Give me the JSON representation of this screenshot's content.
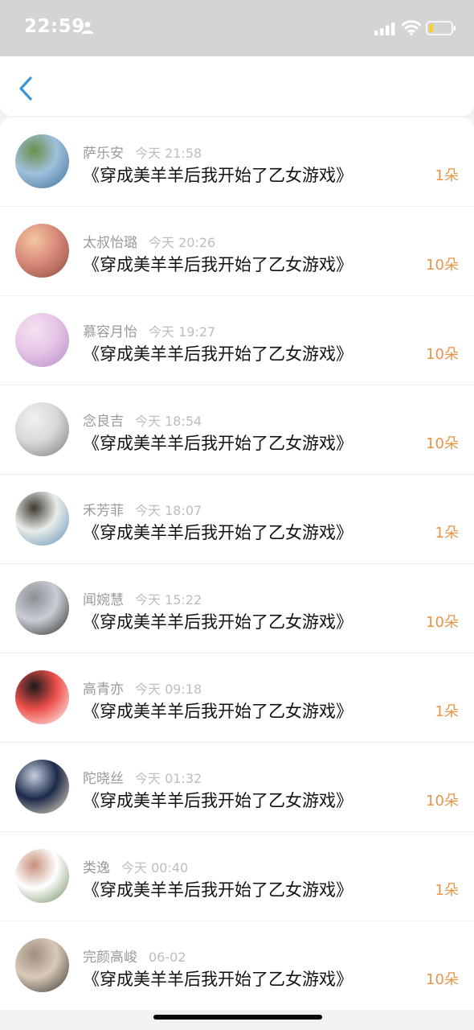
{
  "status_bar": {
    "time": "22:59"
  },
  "gifts": [
    {
      "name": "萨乐安",
      "time": "今天 21:58",
      "book": "《穿成美羊羊后我开始了乙女游戏》",
      "count": "1朵",
      "avatar_colors": [
        "#9fc0dc",
        "#3d6f98",
        "#6b8f4a"
      ]
    },
    {
      "name": "太叔怡璐",
      "time": "今天 20:26",
      "book": "《穿成美羊羊后我开始了乙女游戏》",
      "count": "10朵",
      "avatar_colors": [
        "#d98a7a",
        "#8a4b3f",
        "#f2c7a0"
      ]
    },
    {
      "name": "慕容月怡",
      "time": "今天 19:27",
      "book": "《穿成美羊羊后我开始了乙女游戏》",
      "count": "10朵",
      "avatar_colors": [
        "#e6c6e6",
        "#b58bc7",
        "#f4e1f0"
      ]
    },
    {
      "name": "念良吉",
      "time": "今天 18:54",
      "book": "《穿成美羊羊后我开始了乙女游戏》",
      "count": "10朵",
      "avatar_colors": [
        "#d9d9d9",
        "#7a7a7a",
        "#f0f0f0"
      ]
    },
    {
      "name": "禾芳菲",
      "time": "今天 18:07",
      "book": "《穿成美羊羊后我开始了乙女游戏》",
      "count": "1朵",
      "avatar_colors": [
        "#e9ece8",
        "#5d8fb8",
        "#3f3a32"
      ]
    },
    {
      "name": "闻婉慧",
      "time": "今天 15:22",
      "book": "《穿成美羊羊后我开始了乙女游戏》",
      "count": "10朵",
      "avatar_colors": [
        "#c9cdd3",
        "#2b2b2b",
        "#8c8f94"
      ]
    },
    {
      "name": "高青亦",
      "time": "今天 09:18",
      "book": "《穿成美羊羊后我开始了乙女游戏》",
      "count": "1朵",
      "avatar_colors": [
        "#ee4f4a",
        "#ffffff",
        "#1b1b1b"
      ]
    },
    {
      "name": "陀晓丝",
      "time": "今天 01:32",
      "book": "《穿成美羊羊后我开始了乙女游戏》",
      "count": "10朵",
      "avatar_colors": [
        "#1c2a4a",
        "#f2e6c8",
        "#c7d0e0"
      ]
    },
    {
      "name": "类逸",
      "time": "今天 00:40",
      "book": "《穿成美羊羊后我开始了乙女游戏》",
      "count": "1朵",
      "avatar_colors": [
        "#ffffff",
        "#6e8c5a",
        "#c78f7a"
      ]
    },
    {
      "name": "完颜高峻",
      "time": "06-02",
      "book": "《穿成美羊羊后我开始了乙女游戏》",
      "count": "10朵",
      "avatar_colors": [
        "#d8c9b8",
        "#3a3530",
        "#9f8f80"
      ]
    }
  ],
  "colors": {
    "accent_back": "#3b93d6",
    "count": "#e8954a",
    "battery": "#f4d02e"
  },
  "icons": [
    "person-icon",
    "signal-icon",
    "wifi-icon",
    "battery-icon",
    "back-chevron-icon",
    "avatar"
  ]
}
